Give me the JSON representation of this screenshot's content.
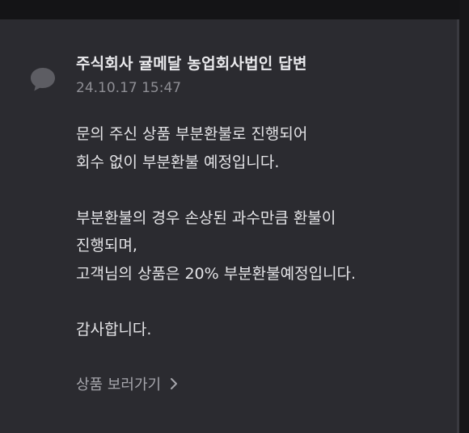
{
  "reply": {
    "author": "주식회사 귤메달 농업회사법인 답변",
    "timestamp": "24.10.17 15:47",
    "lines": [
      "문의 주신 상품 부분환불로 진행되어",
      "회수 없이 부분환불 예정입니다.",
      "",
      "부분환불의 경우 손상된 과수만큼 환불이",
      "진행되며,",
      "고객님의 상품은 20% 부분환불예정입니다.",
      "",
      "감사합니다."
    ],
    "link_label": "상품 보러가기"
  },
  "icons": {
    "avatar": "speech-bubble-icon",
    "link": "chevron-right-icon"
  },
  "colors": {
    "background": "#2b2b30",
    "title": "#e9e9ec",
    "meta": "#8e8e94",
    "body": "#e4e4e7",
    "link": "#a6a6ac",
    "icon": "#5d5d63"
  }
}
